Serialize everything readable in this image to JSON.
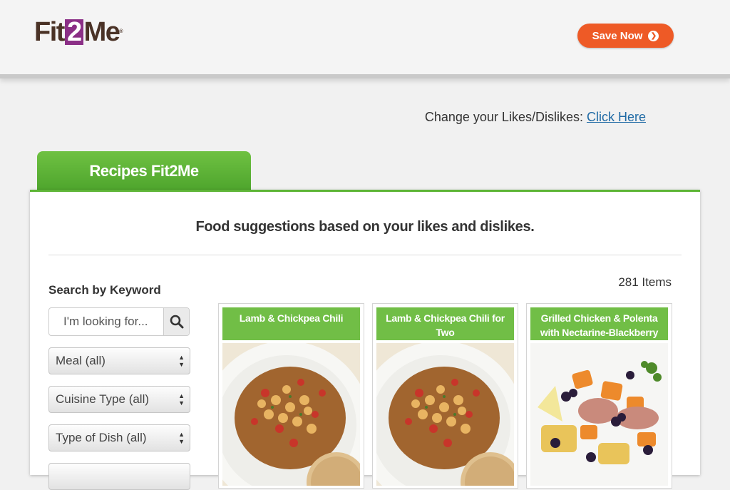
{
  "header": {
    "logo": {
      "prefix": "Fit",
      "two": "2",
      "suffix": "Me",
      "tm": "®"
    },
    "save_button": "Save Now",
    "save_button_icon": "chevron-circle-right-icon"
  },
  "likes": {
    "label": "Change your Likes/Dislikes:",
    "link": "Click Here"
  },
  "tab": {
    "label": "Recipes Fit2Me"
  },
  "panel": {
    "subtitle": "Food suggestions based on your likes and dislikes.",
    "search": {
      "label": "Search by Keyword",
      "placeholder": "I'm looking for...",
      "icon": "search-icon"
    },
    "filters": [
      "Meal (all)",
      "Cuisine Type (all)",
      "Type of Dish (all)"
    ],
    "items_count": "281 Items",
    "recipes": [
      {
        "title": "Lamb & Chickpea Chili"
      },
      {
        "title": "Lamb & Chickpea Chili for Two"
      },
      {
        "title": "Grilled Chicken & Polenta with Nectarine-Blackberry Salsa"
      }
    ]
  },
  "colors": {
    "brand_brown": "#4a3226",
    "brand_purple": "#8b2f86",
    "accent_orange": "#ee5a26",
    "green": "#5eb536",
    "link_blue": "#1f6aa5"
  }
}
